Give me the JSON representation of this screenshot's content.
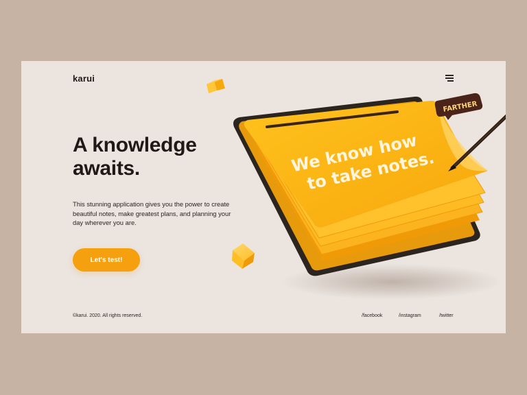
{
  "brand": {
    "logo": "karui"
  },
  "hero": {
    "title_line1": "A knowledge",
    "title_line2": "awaits.",
    "description": "This stunning application gives you the power to create beautiful notes, make greatest plans, and planning your day wherever you are.",
    "cta_label": "Let's test!"
  },
  "illustration": {
    "note_text_line1": "We know how",
    "note_text_line2": "to take notes.",
    "badge": "FARTHER"
  },
  "footer": {
    "copyright": "©karui. 2020. All rights reserved.",
    "social": [
      "/facebook",
      "/instagram",
      "/twitter"
    ]
  },
  "colors": {
    "page_bg": "#c7b3a4",
    "card_bg": "#ebe4df",
    "accent": "#f5a00e",
    "note": "#ffb41a",
    "dark": "#1f1a17"
  },
  "icons": {
    "menu": "hamburger-menu-icon"
  }
}
